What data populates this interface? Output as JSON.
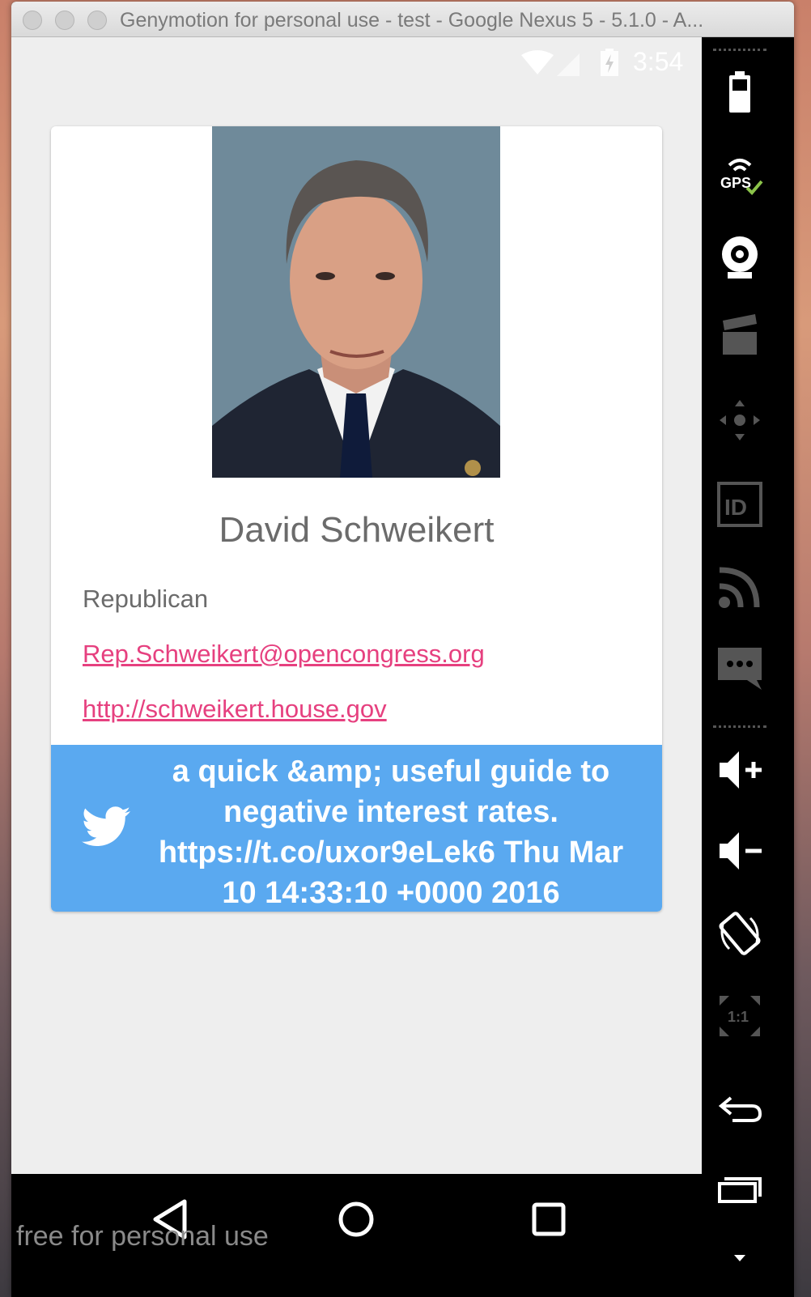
{
  "window": {
    "title": "Genymotion for personal use - test - Google Nexus 5 - 5.1.0 - A..."
  },
  "statusbar": {
    "time": "3:54"
  },
  "profile": {
    "name": "David Schweikert",
    "party": "Republican",
    "email": "Rep.Schweikert@opencongress.org",
    "website": "http://schweikert.house.gov",
    "photo_icon": "portrait-photo"
  },
  "tweet": {
    "icon": "twitter-bird-icon",
    "text": "a quick &amp; useful guide to negative interest rates. https://t.co/uxor9eLek6 Thu Mar 10 14:33:10 +0000 2016",
    "background_color": "#5aa9f0"
  },
  "navbar": {
    "watermark": "free for personal use"
  },
  "toolbar": {
    "gps_label": "GPS",
    "id_label": "ID",
    "pixel_label": "1:1"
  },
  "colors": {
    "link": "#e6407f",
    "text": "#6b6b6b",
    "screen_bg": "#eeeeee"
  }
}
